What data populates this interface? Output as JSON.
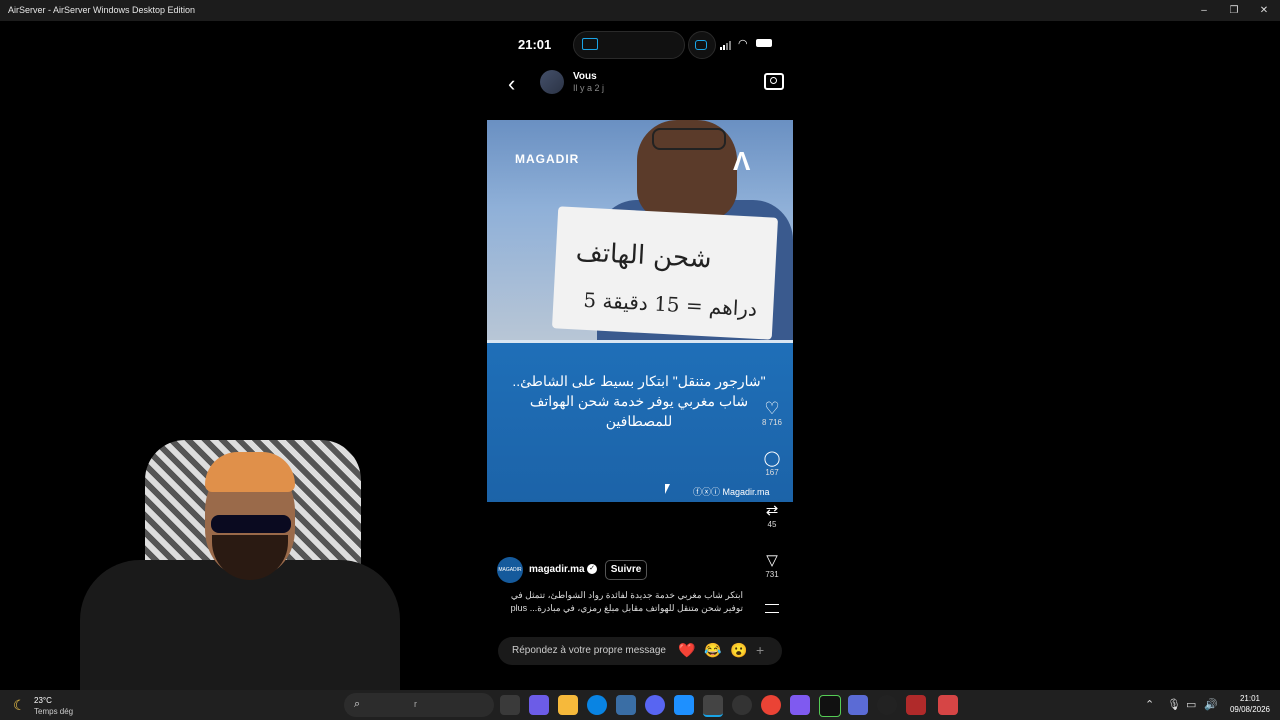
{
  "window": {
    "title": "AirServer - AirServer Windows Desktop Edition",
    "minimize": "–",
    "restore": "❐",
    "close": "✕"
  },
  "phone_status": {
    "time": "21:01"
  },
  "story": {
    "user": "Vous",
    "time_ago": "Il y a 2 j",
    "back_icon": "‹"
  },
  "post": {
    "brand": "MAGADIR",
    "brand_mark": "Λ",
    "sign_line1": "شحن الهاتف",
    "sign_line2": "5 دراهم = 15 دقيقة",
    "headline": "\"شارجور متنقل\" ابتكار بسيط على الشاطئ.. شاب مغربي يوفر خدمة شحن الهواتف للمصطافين",
    "credit": "Magadir.ma"
  },
  "actions": {
    "likes": "8 716",
    "comments": "167",
    "reposts": "45",
    "shares": "731"
  },
  "author": {
    "avatar_text": "MAGADIR",
    "name": "magadir.ma",
    "follow": "Suivre"
  },
  "caption": {
    "text": "ابتكر شاب مغربي خدمة جديدة لفائدة رواد الشواطئ، تتمثل في توفير شحن متنقل للهواتف مقابل مبلغ رمزي، في مبادرة...",
    "more": "plus"
  },
  "reply": {
    "placeholder": "Répondez à votre propre message",
    "emojis": [
      "❤️",
      "😂",
      "😮"
    ],
    "plus": "+"
  },
  "taskbar": {
    "temp": "23°C",
    "weather": "Temps dég",
    "search_hint": "r",
    "time": "21:01",
    "date": "09/08/2026"
  },
  "colors": {
    "accent": "#1aa4e6",
    "post_blue": "#1f6fb8"
  }
}
